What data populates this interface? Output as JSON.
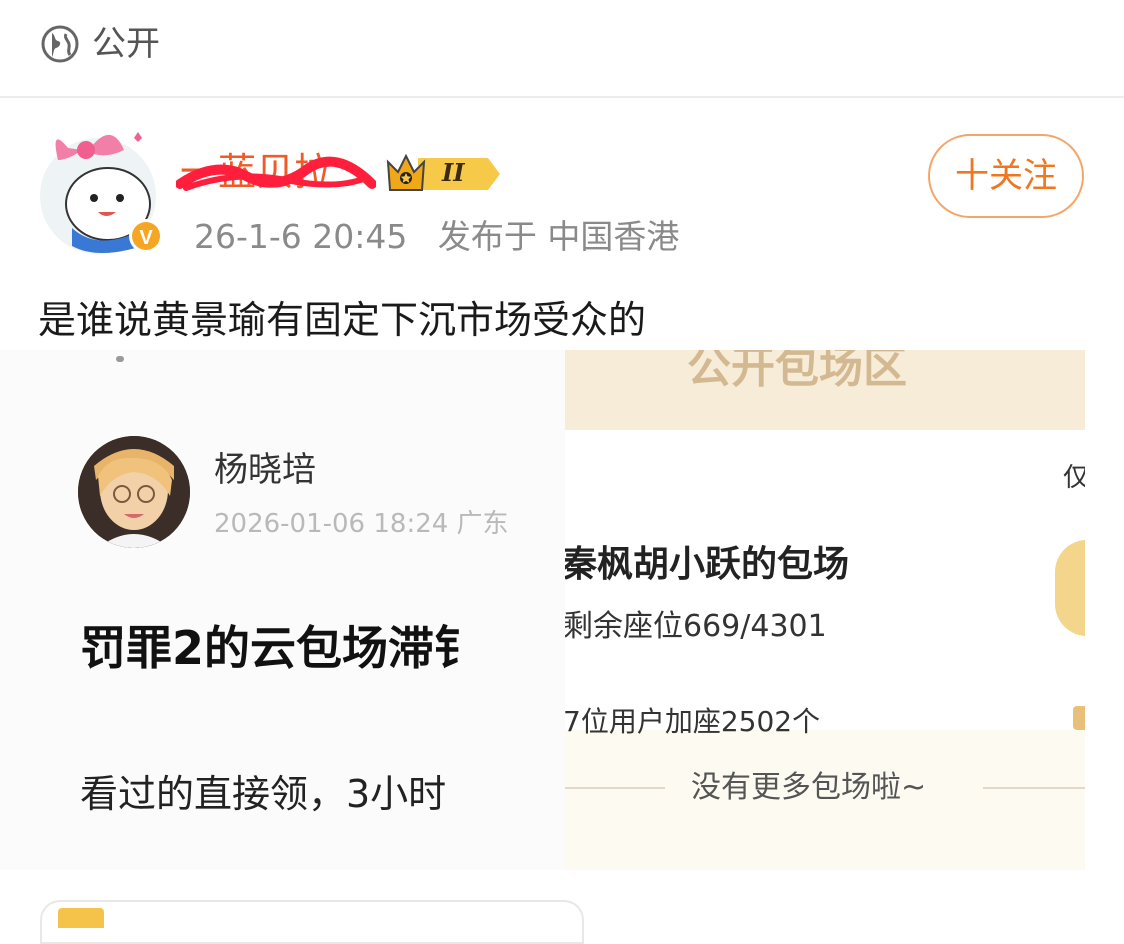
{
  "visibility": {
    "icon": "globe-icon",
    "label": "公开"
  },
  "post": {
    "author": {
      "name": "一蓝贝拉",
      "level_badge": "II",
      "verified_icon": "verified-v-icon"
    },
    "follow_label": "十关注",
    "meta": {
      "time": "26-1-6 20:45",
      "location": "发布于 中国香港"
    },
    "text": "是谁说黄景瑜有固定下沉市场受众的"
  },
  "embedded": {
    "left": {
      "author": "杨晓培",
      "date": "2026-01-06 18:24 广东",
      "title": "罚罪2的云包场滞钅",
      "body": "看过的直接领，3小时"
    },
    "right": {
      "header": "公开包场区",
      "edge_char": "仅",
      "title": "秦枫胡小跃的包场",
      "seats": "剩余座位669/4301",
      "users": "7位用户加座2502个",
      "footer": "没有更多包场啦~"
    }
  },
  "colors": {
    "accent": "#f0761f",
    "name": "#f05a28",
    "muted": "#8a8a8a",
    "border": "#f4a66a"
  }
}
